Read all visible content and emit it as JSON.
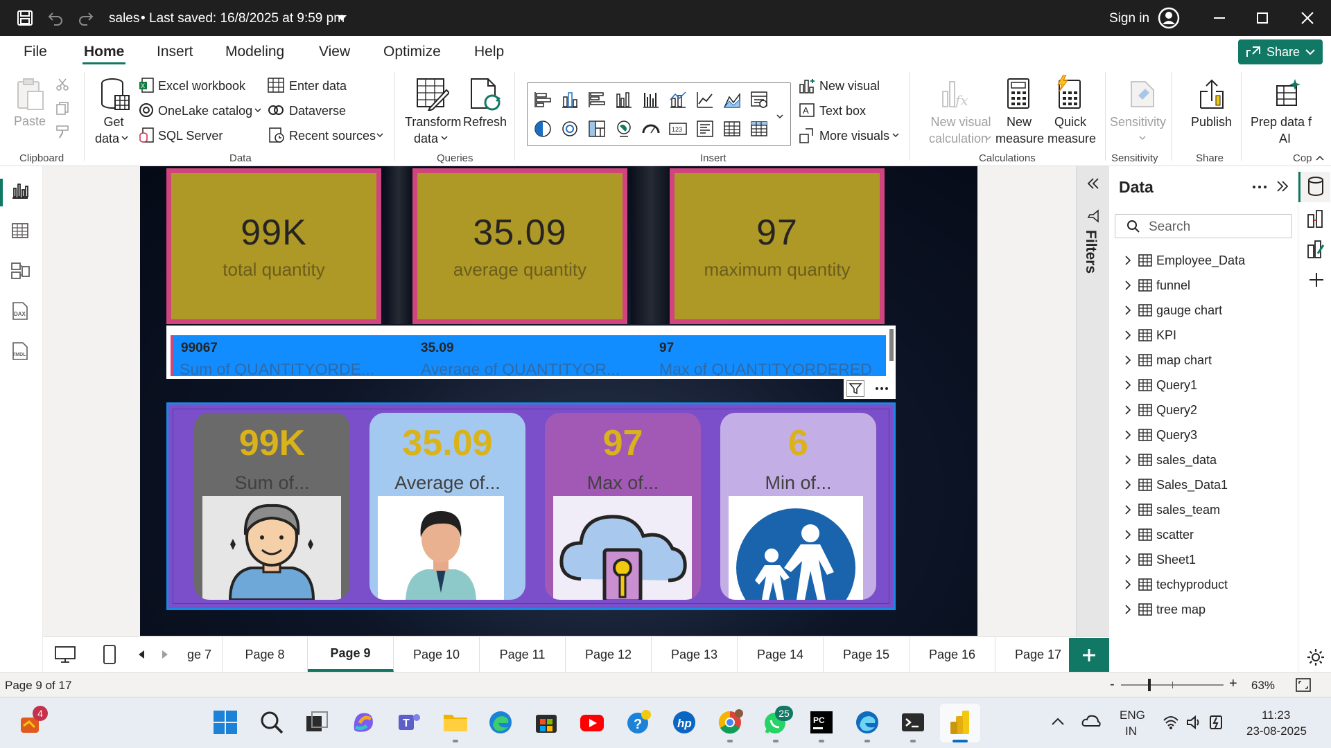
{
  "titlebar": {
    "file_title": "sales",
    "saved_status": "Last saved: 16/8/2025 at 9:59 pm",
    "sign_in": "Sign in"
  },
  "menu": {
    "items": [
      "File",
      "Home",
      "Insert",
      "Modeling",
      "View",
      "Optimize",
      "Help"
    ],
    "active": "Home",
    "share": "Share"
  },
  "ribbon": {
    "clipboard": {
      "paste": "Paste",
      "group": "Clipboard"
    },
    "data": {
      "get_data_1": "Get",
      "get_data_2": "data",
      "excel": "Excel workbook",
      "onelake": "OneLake catalog",
      "sql": "SQL Server",
      "enter": "Enter data",
      "dataverse": "Dataverse",
      "recent": "Recent sources",
      "group": "Data"
    },
    "queries": {
      "transform_1": "Transform",
      "transform_2": "data",
      "refresh": "Refresh",
      "group": "Queries"
    },
    "insert": {
      "new_visual": "New visual",
      "text_box": "Text box",
      "more_visuals": "More visuals",
      "group": "Insert"
    },
    "calculations": {
      "new_visual_calc_1": "New visual",
      "new_visual_calc_2": "calculation",
      "new_measure_1": "New",
      "new_measure_2": "measure",
      "quick_measure_1": "Quick",
      "quick_measure_2": "measure",
      "group": "Calculations"
    },
    "sensitivity": {
      "label": "Sensitivity",
      "group": "Sensitivity"
    },
    "share": {
      "publish": "Publish",
      "group": "Share"
    },
    "copilot": {
      "prep_1": "Prep data f",
      "prep_2": "AI",
      "group": "Cop"
    }
  },
  "cards": [
    {
      "value": "99K",
      "label": "total quantity"
    },
    {
      "value": "35.09",
      "label": "average quantity"
    },
    {
      "value": "97",
      "label": "maximum quantity"
    }
  ],
  "multirow": [
    {
      "value": "99067",
      "label": "Sum of QUANTITYORDE..."
    },
    {
      "value": "35.09",
      "label": "Average of QUANTITYOR..."
    },
    {
      "value": "97",
      "label": "Max of QUANTITYORDERED"
    }
  ],
  "tiles": [
    {
      "value": "99K",
      "label": "Sum of...",
      "bg": "#6a6a6a"
    },
    {
      "value": "35.09",
      "label": "Average of...",
      "bg": "#a3c9f0"
    },
    {
      "value": "97",
      "label": "Max of...",
      "bg": "#a259b5"
    },
    {
      "value": "6",
      "label": "Min of...",
      "bg": "#c4aee6"
    }
  ],
  "filters_label": "Filters",
  "data_pane": {
    "title": "Data",
    "search_placeholder": "Search",
    "tables": [
      "Employee_Data",
      "funnel",
      "gauge chart",
      "KPI",
      "map chart",
      "Query1",
      "Query2",
      "Query3",
      "sales_data",
      "Sales_Data1",
      "sales_team",
      "scatter",
      "Sheet1",
      "techyproduct",
      "tree map"
    ]
  },
  "pages": {
    "tabs": [
      "ge 7",
      "Page 8",
      "Page 9",
      "Page 10",
      "Page 11",
      "Page 12",
      "Page 13",
      "Page 14",
      "Page 15",
      "Page 16",
      "Page 17"
    ],
    "active": "Page 9"
  },
  "status": {
    "page_info": "Page 9 of 17",
    "zoom": "63%"
  },
  "taskbar": {
    "badge_widgets": "4",
    "badge_whatsapp": "25",
    "lang_1": "ENG",
    "lang_2": "IN",
    "time": "11:23",
    "date": "23-08-2025"
  },
  "colors": {
    "accent": "#117865",
    "card_bg": "#ae9826",
    "card_border": "#d0457e",
    "multirow_bg": "#118dff",
    "panel_bg": "#7b4fc9"
  }
}
